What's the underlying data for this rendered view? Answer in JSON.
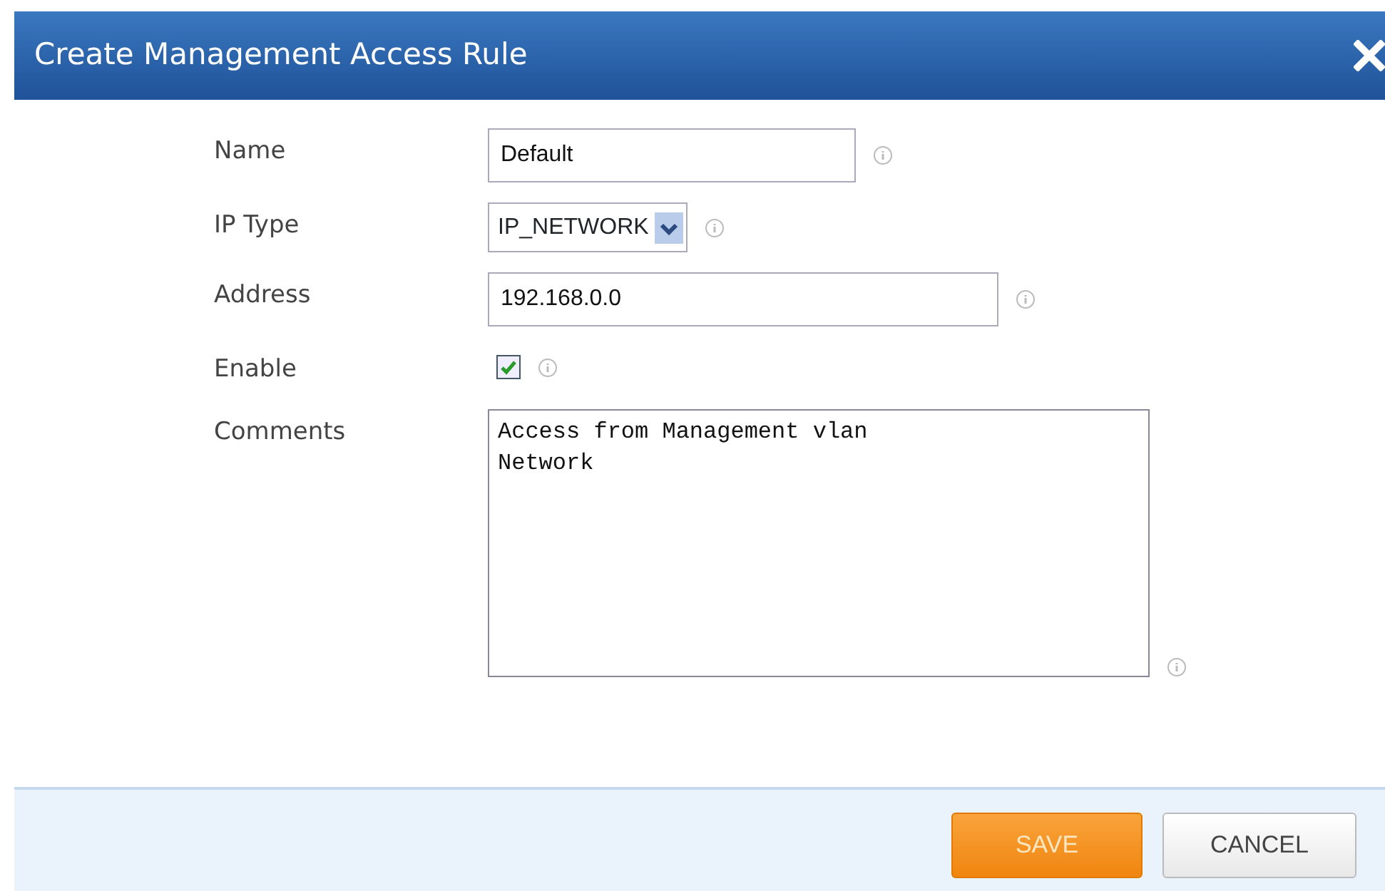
{
  "dialog": {
    "title": "Create Management Access Rule"
  },
  "fields": [
    {
      "kind": "text",
      "label": "Name",
      "value": "Default"
    },
    {
      "kind": "select",
      "label": "IP Type",
      "value": "IP_NETWORK"
    },
    {
      "kind": "text",
      "label": "Address",
      "value": "192.168.0.0"
    },
    {
      "kind": "checkbox",
      "label": "Enable",
      "checked": true
    },
    {
      "kind": "textarea",
      "label": "Comments",
      "value": "Access from Management vlan\nNetwork"
    }
  ],
  "buttons": [
    {
      "kind": "primary",
      "label": "SAVE"
    },
    {
      "kind": "secondary",
      "label": "CANCEL"
    }
  ]
}
